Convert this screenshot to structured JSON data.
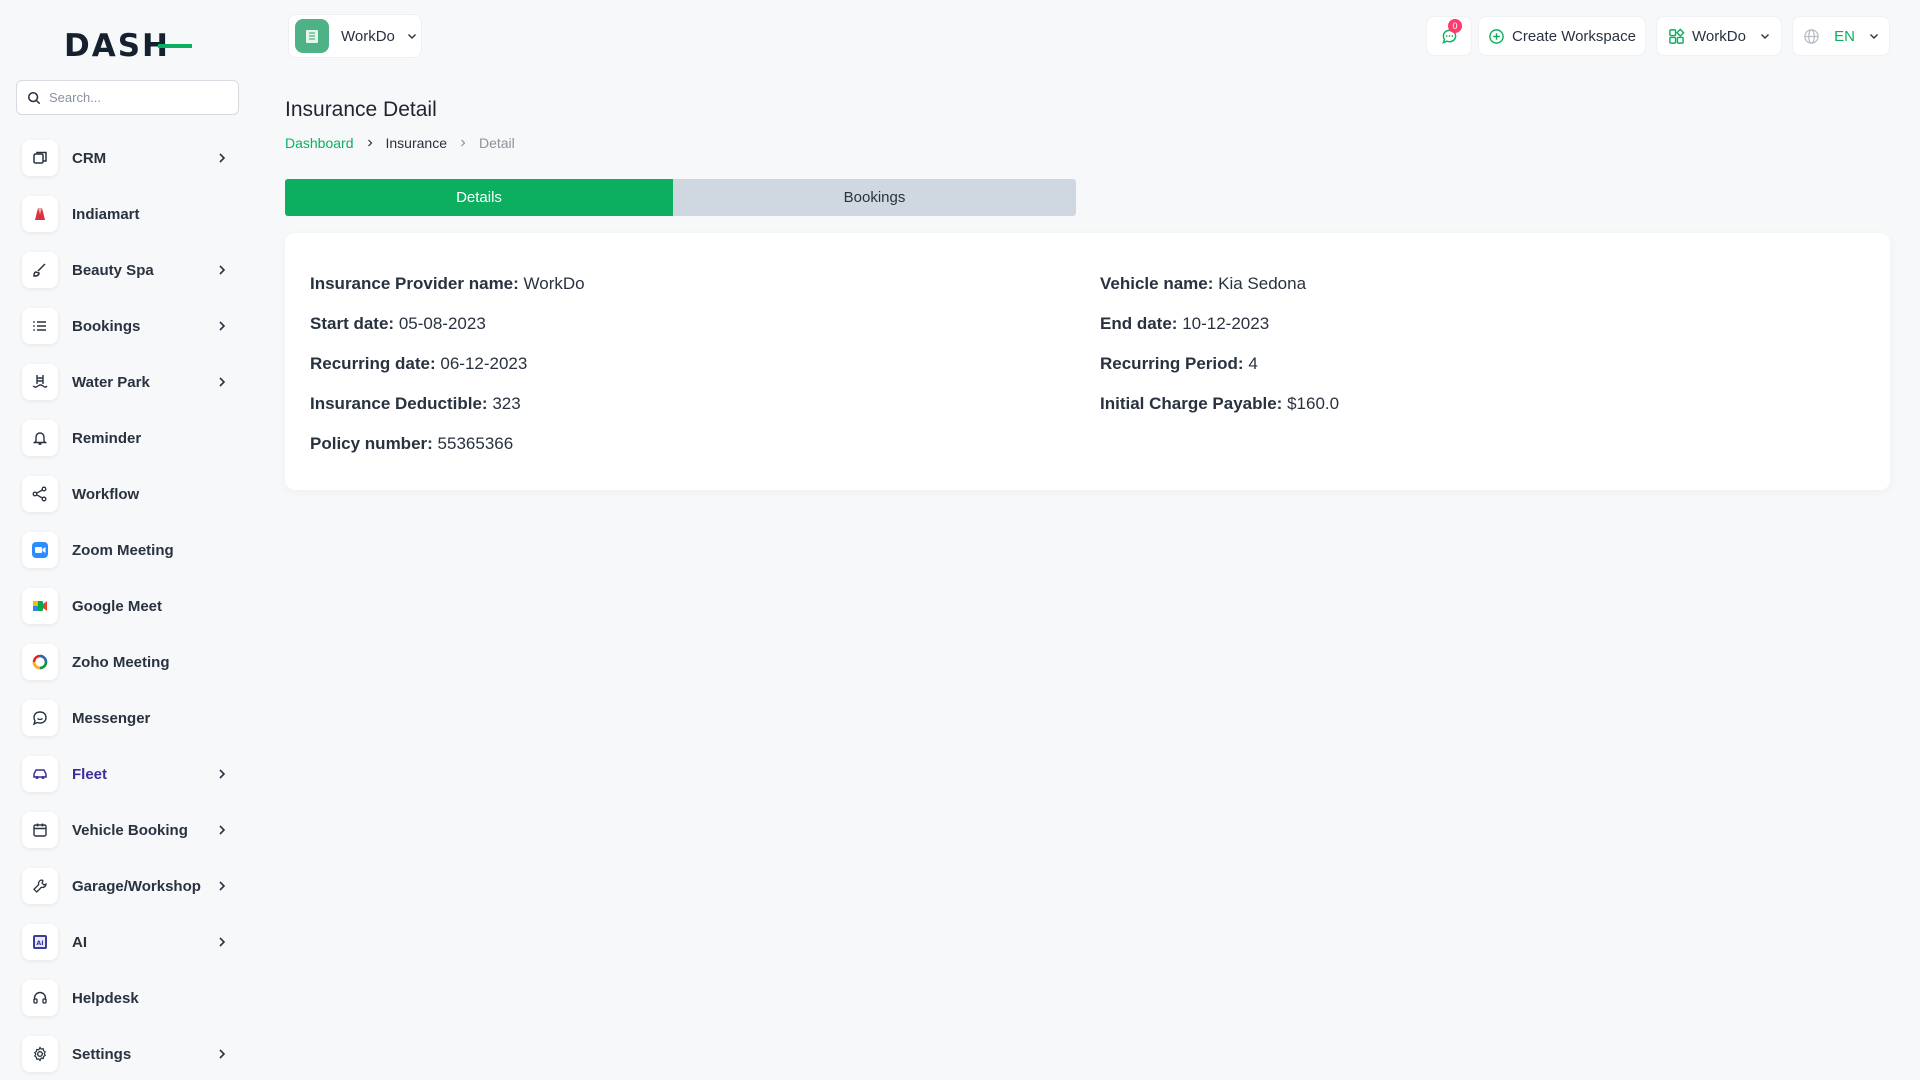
{
  "sidebar": {
    "logo_text": "DASH",
    "search_placeholder": "Search...",
    "items": [
      {
        "label": "CRM",
        "icon": "layers-icon",
        "chevron": true
      },
      {
        "label": "Indiamart",
        "icon": "indiamart-logo-icon",
        "chevron": false
      },
      {
        "label": "Beauty Spa",
        "icon": "brush-icon",
        "chevron": true
      },
      {
        "label": "Bookings",
        "icon": "list-icon",
        "chevron": true
      },
      {
        "label": "Water Park",
        "icon": "pool-icon",
        "chevron": true
      },
      {
        "label": "Reminder",
        "icon": "bell-icon",
        "chevron": false
      },
      {
        "label": "Workflow",
        "icon": "share-icon",
        "chevron": false
      },
      {
        "label": "Zoom Meeting",
        "icon": "zoom-logo-icon",
        "chevron": false
      },
      {
        "label": "Google Meet",
        "icon": "google-meet-logo-icon",
        "chevron": false
      },
      {
        "label": "Zoho Meeting",
        "icon": "zoho-logo-icon",
        "chevron": false
      },
      {
        "label": "Messenger",
        "icon": "chat-icon",
        "chevron": false
      },
      {
        "label": "Fleet",
        "icon": "car-icon",
        "chevron": true,
        "active": true
      },
      {
        "label": "Vehicle Booking",
        "icon": "calendar-icon",
        "chevron": true
      },
      {
        "label": "Garage/Workshop",
        "icon": "wrench-icon",
        "chevron": true
      },
      {
        "label": "AI",
        "icon": "ai-chip-icon",
        "chevron": true
      },
      {
        "label": "Helpdesk",
        "icon": "headset-icon",
        "chevron": false
      },
      {
        "label": "Settings",
        "icon": "gear-icon",
        "chevron": true
      }
    ]
  },
  "header": {
    "workspace": "WorkDo",
    "message_count": "0",
    "create_workspace": "Create Workspace",
    "workspace_switch": "WorkDo",
    "language": "EN"
  },
  "page": {
    "title": "Insurance Detail",
    "breadcrumb": [
      "Dashboard",
      "Insurance",
      "Detail"
    ]
  },
  "tabs": {
    "details": "Details",
    "bookings": "Bookings"
  },
  "details": {
    "left": [
      {
        "label": "Insurance Provider name:",
        "value": "WorkDo"
      },
      {
        "label": "Start date:",
        "value": "05-08-2023"
      },
      {
        "label": "Recurring date:",
        "value": "06-12-2023"
      },
      {
        "label": "Insurance Deductible:",
        "value": "323"
      },
      {
        "label": "Policy number:",
        "value": "55365366"
      }
    ],
    "right": [
      {
        "label": "Vehicle name:",
        "value": "Kia Sedona"
      },
      {
        "label": "End date:",
        "value": "10-12-2023"
      },
      {
        "label": "Recurring Period:",
        "value": "4"
      },
      {
        "label": "Initial Charge Payable:",
        "value": "$160.0"
      }
    ]
  },
  "colors": {
    "accent": "#0caf60",
    "active_nav": "#3a2e9d",
    "tab_inactive": "#cfd8e1",
    "badge": "#ff3a6e"
  }
}
